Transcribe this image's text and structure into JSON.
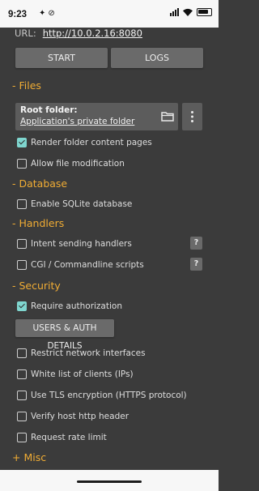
{
  "status_bar": {
    "time": "9:23",
    "notification_icons": [
      "sparkle-icon",
      "do-not-disturb-icon"
    ],
    "system_icons": [
      "signal-icon",
      "wifi-icon",
      "battery-icon"
    ]
  },
  "server": {
    "url_label": "URL:",
    "url_value": "http://10.0.2.16:8080",
    "start_label": "START",
    "logs_label": "LOGS"
  },
  "sections": {
    "files": "- Files",
    "database": "- Database",
    "handlers": "- Handlers",
    "security": "- Security",
    "misc": "+ Misc"
  },
  "files": {
    "root_title": "Root folder:",
    "root_value": "Application's private folder",
    "options": [
      {
        "label": "Render folder content pages",
        "checked": true
      },
      {
        "label": "Allow file modification",
        "checked": false
      }
    ]
  },
  "database": {
    "options": [
      {
        "label": "Enable SQLite database",
        "checked": false
      }
    ]
  },
  "handlers": {
    "help_label": "?",
    "options": [
      {
        "label": "Intent sending handlers",
        "checked": false
      },
      {
        "label": "CGI / Commandline scripts",
        "checked": false
      }
    ]
  },
  "security": {
    "users_button_label": "USERS & AUTH DETAILS",
    "options": [
      {
        "label": "Require authorization",
        "checked": true
      },
      {
        "label": "Restrict network interfaces",
        "checked": false
      },
      {
        "label": "White list of clients (IPs)",
        "checked": false
      },
      {
        "label": "Use TLS encryption (HTTPS protocol)",
        "checked": false
      },
      {
        "label": "Verify host http header",
        "checked": false
      },
      {
        "label": "Request rate limit",
        "checked": false
      }
    ]
  },
  "colors": {
    "background": "#3b3b3b",
    "section_header": "#f0ac34",
    "checkbox_checked": "#7fd6cf",
    "button": "#6a6a6a"
  }
}
